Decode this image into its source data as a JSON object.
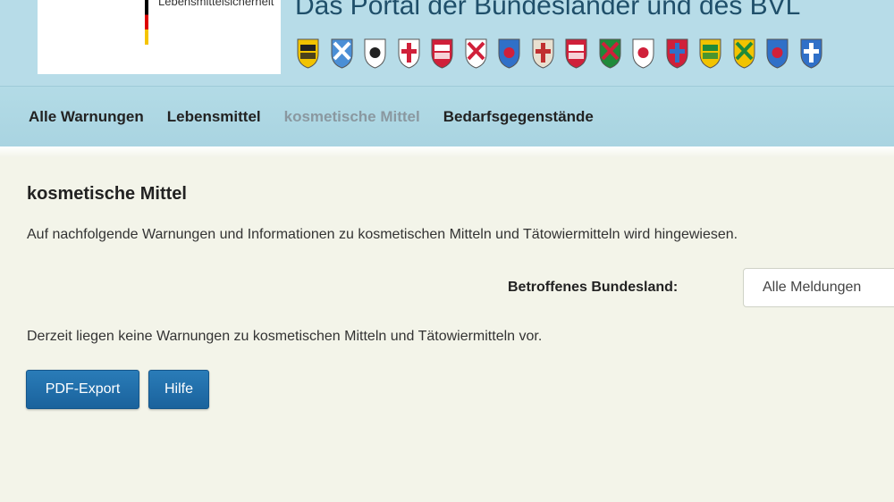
{
  "header": {
    "logo_text": "Lebensmittelsicherheit",
    "portal_title": "Das Portal der Bundesländer und des BVL",
    "crests": [
      {
        "icon": "baden-wuerttemberg-crest-icon",
        "colors": [
          "#f2c300",
          "#222222"
        ]
      },
      {
        "icon": "bayern-crest-icon",
        "colors": [
          "#4b8fd6",
          "#ffffff"
        ]
      },
      {
        "icon": "berlin-crest-icon",
        "colors": [
          "#ffffff",
          "#222222"
        ]
      },
      {
        "icon": "brandenburg-crest-icon",
        "colors": [
          "#ffffff",
          "#d0203a"
        ]
      },
      {
        "icon": "bremen-crest-icon",
        "colors": [
          "#d0203a",
          "#ffffff"
        ]
      },
      {
        "icon": "hamburg-crest-icon",
        "colors": [
          "#ffffff",
          "#d0203a"
        ]
      },
      {
        "icon": "hessen-crest-icon",
        "colors": [
          "#3070c8",
          "#d0203a"
        ]
      },
      {
        "icon": "mecklenburg-vorpommern-crest-icon",
        "colors": [
          "#e8e0d0",
          "#c03030"
        ]
      },
      {
        "icon": "niedersachsen-crest-icon",
        "colors": [
          "#d0203a",
          "#ffffff"
        ]
      },
      {
        "icon": "nordrhein-westfalen-crest-icon",
        "colors": [
          "#1f8a3a",
          "#d0203a"
        ]
      },
      {
        "icon": "rheinland-pfalz-crest-icon",
        "colors": [
          "#ffffff",
          "#d0203a"
        ]
      },
      {
        "icon": "saarland-crest-icon",
        "colors": [
          "#d0203a",
          "#3070c8"
        ]
      },
      {
        "icon": "sachsen-crest-icon",
        "colors": [
          "#f2c300",
          "#1f8a3a"
        ]
      },
      {
        "icon": "sachsen-anhalt-crest-icon",
        "colors": [
          "#f2c300",
          "#1f8a3a"
        ]
      },
      {
        "icon": "schleswig-holstein-crest-icon",
        "colors": [
          "#3070c8",
          "#d0203a"
        ]
      },
      {
        "icon": "thueringen-crest-icon",
        "colors": [
          "#3070c8",
          "#ffffff"
        ]
      }
    ]
  },
  "nav": {
    "items": [
      {
        "label": "Alle Warnungen",
        "active": false
      },
      {
        "label": "Lebensmittel",
        "active": false
      },
      {
        "label": "kosmetische Mittel",
        "active": true
      },
      {
        "label": "Bedarfsgegenstände",
        "active": false
      }
    ]
  },
  "main": {
    "title": "kosmetische Mittel",
    "intro": "Auf nachfolgende Warnungen und Informationen zu kosmetischen Mitteln und Tätowiermitteln wird hingewiesen.",
    "filter_label": "Betroffenes Bundesland:",
    "filter_value": "Alle Meldungen",
    "empty_note": "Derzeit liegen keine Warnungen zu kosmetischen Mitteln und Tätowiermitteln vor.",
    "pdf_button": "PDF-Export",
    "help_button": "Hilfe"
  },
  "colors": {
    "header_bg": "#b7dce8",
    "content_bg": "#f3f4e9",
    "button_bg": "#1f6da8",
    "active_nav": "#8a98a0"
  }
}
